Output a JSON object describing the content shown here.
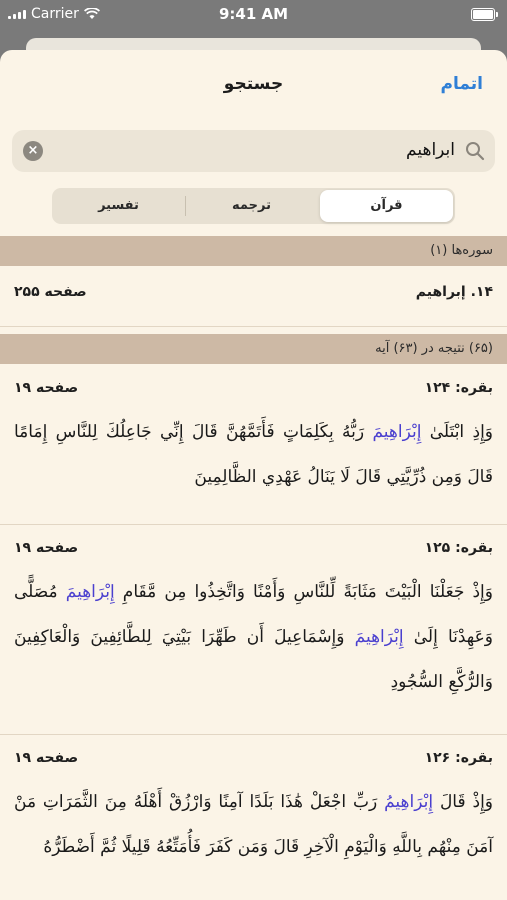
{
  "status": {
    "carrier": "Carrier",
    "time": "9:41 AM"
  },
  "nav": {
    "title": "جستجو",
    "done": "اتمام"
  },
  "search": {
    "query": "ابراهیم",
    "clear": "×"
  },
  "tabs": [
    {
      "label": "قرآن",
      "active": true
    },
    {
      "label": "ترجمه"
    },
    {
      "label": "تفسیر"
    }
  ],
  "surahs": {
    "header": "سوره‌ها (۱)",
    "items": [
      {
        "name": "۱۴. إبراهيم",
        "page": "صفحه ۲۵۵"
      }
    ]
  },
  "results": {
    "header": "(۶۵) نتیجه در (۶۳) آیه",
    "items": [
      {
        "ref": "بقره: ۱۲۴",
        "page": "صفحه ۱۹",
        "before": "وَإِذِ ابْتَلَىٰ ",
        "match": "إِبْرَاهِيمَ",
        "after": " رَبُّهُ بِكَلِمَاتٍ فَأَتَمَّهُنَّ قَالَ إِنِّي جَاعِلُكَ لِلنَّاسِ إِمَامًا قَالَ وَمِن ذُرِّيَّتِي قَالَ لَا يَنَالُ عَهْدِي الظَّالِمِينَ"
      },
      {
        "ref": "بقره: ۱۲۵",
        "page": "صفحه ۱۹",
        "before": "وَإِذْ جَعَلْنَا الْبَيْتَ مَثَابَةً لِّلنَّاسِ وَأَمْنًا وَاتَّخِذُوا مِن مَّقَامِ ",
        "match": "إِبْرَاهِيمَ",
        "mid": " مُصَلًّى وَعَهِدْنَا إِلَىٰ ",
        "match2": "إِبْرَاهِيمَ",
        "after": " وَإِسْمَاعِيلَ أَن طَهِّرَا بَيْتِيَ لِلطَّائِفِينَ وَالْعَاكِفِينَ وَالرُّكَّعِ السُّجُودِ"
      },
      {
        "ref": "بقره: ۱۲۶",
        "page": "صفحه ۱۹",
        "before": "وَإِذْ قَالَ ",
        "match": "إِبْرَاهِيمُ",
        "after": " رَبِّ اجْعَلْ هَٰذَا بَلَدًا آمِنًا وَارْزُقْ أَهْلَهُ مِنَ الثَّمَرَاتِ مَنْ آمَنَ مِنْهُم بِاللَّهِ وَالْيَوْمِ الْآخِرِ قَالَ وَمَن كَفَرَ فَأُمَتِّعُهُ قَلِيلًا ثُمَّ أَضْطَرُّهُ"
      }
    ]
  }
}
